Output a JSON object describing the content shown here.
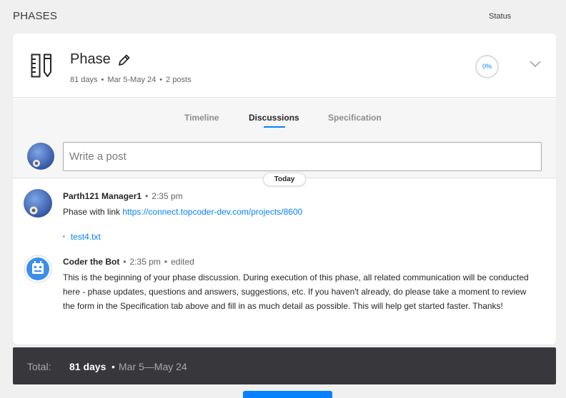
{
  "header": {
    "section_title": "PHASES",
    "status_label": "Status"
  },
  "phase": {
    "icon": "ruler-pencil-icon",
    "name": "Phase",
    "duration": "81 days",
    "date_range": "Mar 5-May 24",
    "posts_count": "2 posts",
    "progress_text": "0%",
    "progress_value": 0
  },
  "tabs": [
    {
      "label": "Timeline"
    },
    {
      "label": "Discussions"
    },
    {
      "label": "Specification"
    }
  ],
  "active_tab": "Discussions",
  "composer": {
    "placeholder": "Write a post"
  },
  "day_divider": "Today",
  "posts": [
    {
      "author": "Parth121 Manager1",
      "time": "2:35 pm",
      "body_prefix": "Phase with link ",
      "link_text": "https://connect.topcoder-dev.com/projects/8600",
      "attachment": "test4.txt"
    },
    {
      "author": "Coder the Bot",
      "time": "2:35 pm",
      "edited_label": "edited",
      "body": "This is the beginning of your phase discussion. During execution of this phase, all related communication will be conducted here - phase updates, questions and answers, suggestions, etc. If you haven't already, do please take a moment to review the form in the Specification tab above and fill in as much detail as possible. This will help get started faster. Thanks!"
    }
  ],
  "total": {
    "label": "Total:",
    "days": "81 days",
    "dates": "Mar 5—May 24"
  },
  "colors": {
    "accent": "#0681ff",
    "footer_bg": "#37373c",
    "page_bg": "#f0f0f0"
  }
}
